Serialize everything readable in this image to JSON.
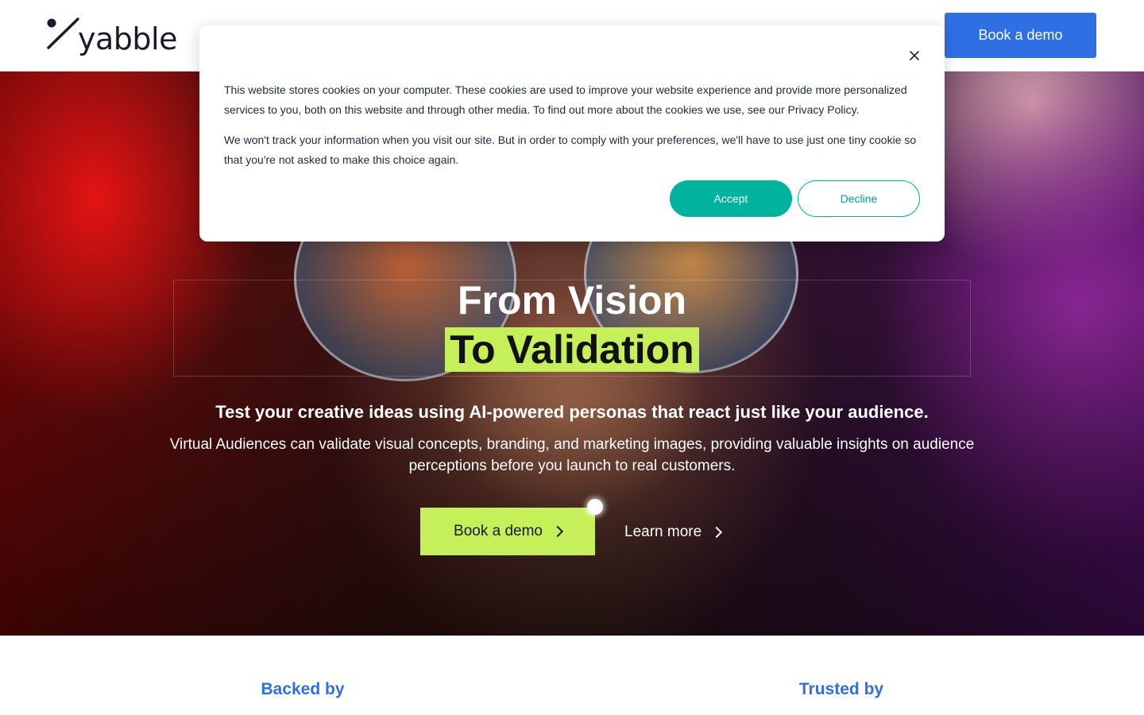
{
  "header": {
    "logo_text": "yabble",
    "demo_button": "Book a demo"
  },
  "cookie": {
    "paragraph1": "This website stores cookies on your computer. These cookies are used to improve your website experience and provide more personalized services to you, both on this website and through other media. To find out more about the cookies we use, see our Privacy Policy.",
    "paragraph2": "We won't track your information when you visit our site. But in order to comply with your preferences, we'll have to use just one tiny cookie so that you're not asked to make this choice again.",
    "accept": "Accept",
    "decline": "Decline",
    "close_icon": "close-icon"
  },
  "hero": {
    "title_line1": "From Vision",
    "title_line2": "To Validation",
    "subtitle": "Test your creative ideas using AI-powered personas that react just like your audience.",
    "description": "Virtual Audiences can validate visual concepts, branding, and marketing images, providing valuable insights on audience perceptions before you launch to real customers.",
    "demo_button": "Book a demo",
    "learn_more": "Learn more",
    "highlight_color": "#c5f05a"
  },
  "sections": {
    "backed_by": "Backed by",
    "trusted_by": "Trusted by"
  },
  "colors": {
    "brand_blue": "#2f6fe4",
    "accept_teal": "#00b39e",
    "lime": "#c5f05a"
  }
}
